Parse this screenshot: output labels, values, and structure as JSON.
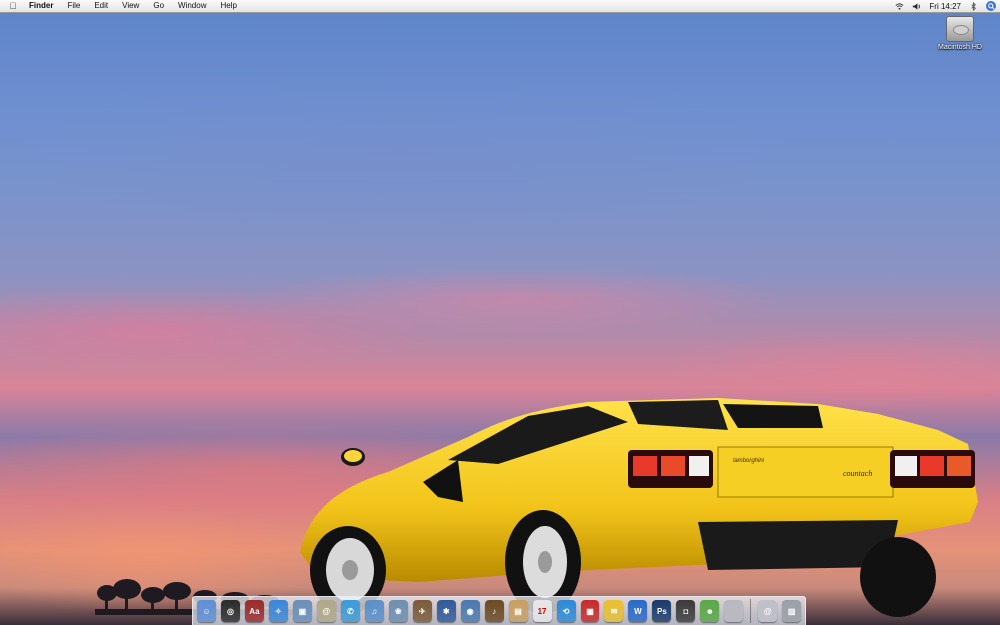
{
  "menubar": {
    "apple_icon": "apple-icon",
    "app_name": "Finder",
    "menus": [
      "File",
      "Edit",
      "View",
      "Go",
      "Window",
      "Help"
    ],
    "clock": "Fri 14:27",
    "status_icons": [
      "wifi-icon",
      "volume-icon",
      "bluetooth-icon",
      "spotlight-icon"
    ]
  },
  "desktop": {
    "hd_label": "Macintosh HD"
  },
  "car": {
    "brand_badge": "lamborghini",
    "model_badge": "countach"
  },
  "dock": {
    "apps": [
      {
        "name": "finder",
        "color": "#5f8fd6",
        "glyph": "☺"
      },
      {
        "name": "dashboard",
        "color": "#2b2b2b",
        "glyph": "◎"
      },
      {
        "name": "dictionary",
        "color": "#9b2a2a",
        "glyph": "Aa"
      },
      {
        "name": "safari",
        "color": "#3a86d9",
        "glyph": "✧"
      },
      {
        "name": "preview",
        "color": "#6a8fb8",
        "glyph": "▣"
      },
      {
        "name": "mail",
        "color": "#b0a888",
        "glyph": "@"
      },
      {
        "name": "ichat",
        "color": "#3d9bd8",
        "glyph": "✆"
      },
      {
        "name": "itunes",
        "color": "#5a8fc8",
        "glyph": "♫"
      },
      {
        "name": "iphoto",
        "color": "#6d8fb0",
        "glyph": "❀"
      },
      {
        "name": "iweb",
        "color": "#7a5a38",
        "glyph": "✈"
      },
      {
        "name": "imovie",
        "color": "#2f5a9a",
        "glyph": "✱"
      },
      {
        "name": "idvd",
        "color": "#4a7ab0",
        "glyph": "◉"
      },
      {
        "name": "garageband",
        "color": "#6b4a22",
        "glyph": "♪"
      },
      {
        "name": "address-book",
        "color": "#c8a060",
        "glyph": "▤"
      },
      {
        "name": "ical",
        "color": "#e8e8e8",
        "glyph": "17"
      },
      {
        "name": "time-machine",
        "color": "#2c8ad8",
        "glyph": "⟲"
      },
      {
        "name": "photo-booth",
        "color": "#c82a2a",
        "glyph": "▦"
      },
      {
        "name": "stickies",
        "color": "#e8c030",
        "glyph": "✉"
      },
      {
        "name": "word",
        "color": "#2a6ac8",
        "glyph": "W"
      },
      {
        "name": "photoshop",
        "color": "#1a3a6a",
        "glyph": "Ps"
      },
      {
        "name": "camera",
        "color": "#3a3a3a",
        "glyph": "◘"
      },
      {
        "name": "adium",
        "color": "#58a848",
        "glyph": "☻"
      },
      {
        "name": "system-preferences",
        "color": "#b8b8c0",
        "glyph": ""
      }
    ],
    "stacks": [
      {
        "name": "downloads-stack",
        "color": "#c0c0c8",
        "glyph": "@"
      },
      {
        "name": "trash",
        "color": "#9aa0a8",
        "glyph": "▥"
      }
    ]
  }
}
